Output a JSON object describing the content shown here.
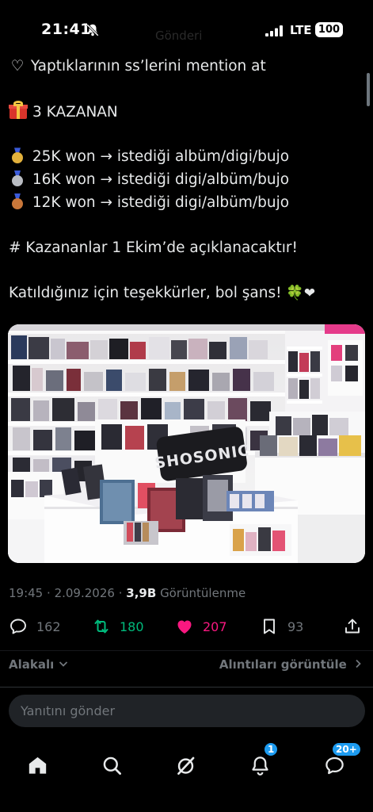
{
  "status_bar": {
    "time": "21:41",
    "network": "LTE",
    "battery": "100",
    "ghost_title": "Gönderi"
  },
  "tweet": {
    "lines": [
      "Yaptıklarının ss’lerini mention at",
      "3 KAZANAN",
      "25K won → istediği albüm/digi/bujo",
      "16K won → istediği digi/albüm/bujo",
      "12K won → istediği digi/albüm/bujo",
      "# Kazananlar 1 Ekim’de açıklanacaktır!",
      "Katıldığınız için teşekkürler, bol şans!"
    ],
    "emojis": {
      "heart_outline": "♡",
      "clover": "🍀",
      "heart": "❤"
    },
    "medal_colors": [
      "#e2b13c",
      "#b9bcc2",
      "#c9773a"
    ],
    "image_sign_text": "SHOSONIC"
  },
  "meta": {
    "time": "19:45",
    "separator": "·",
    "date": "2.09.2026",
    "views": "3,9B",
    "views_label": "Görüntülenme"
  },
  "actions": {
    "replies": "162",
    "reposts": "180",
    "likes": "207",
    "bookmarks": "93"
  },
  "colors": {
    "repost": "#00ba7c",
    "like": "#f91880",
    "accent": "#1d9bf0",
    "muted": "#71767b"
  },
  "sort": {
    "label": "Alakalı",
    "quotes": "Alıntıları görüntüle"
  },
  "reply": {
    "placeholder": "Yanıtını gönder"
  },
  "tabbar": {
    "notifications_badge": "1",
    "messages_badge": "20+"
  }
}
